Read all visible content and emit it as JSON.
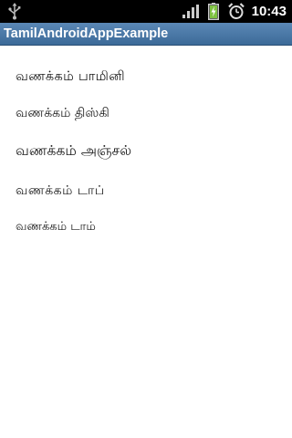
{
  "status_bar": {
    "time": "10:43",
    "icons": [
      "usb-icon",
      "signal-icon",
      "battery-charging-icon",
      "alarm-clock-icon"
    ]
  },
  "app": {
    "title": "TamilAndroidAppExample",
    "title_bar_color": "#4a79a8"
  },
  "greetings": [
    "வணக்கம் பாமினி",
    "வணக்கம் திஸ்கி",
    "வணக்கம் அஞ்சல்",
    "வணக்கம் டாப்",
    "வணக்கம் டாம்"
  ]
}
